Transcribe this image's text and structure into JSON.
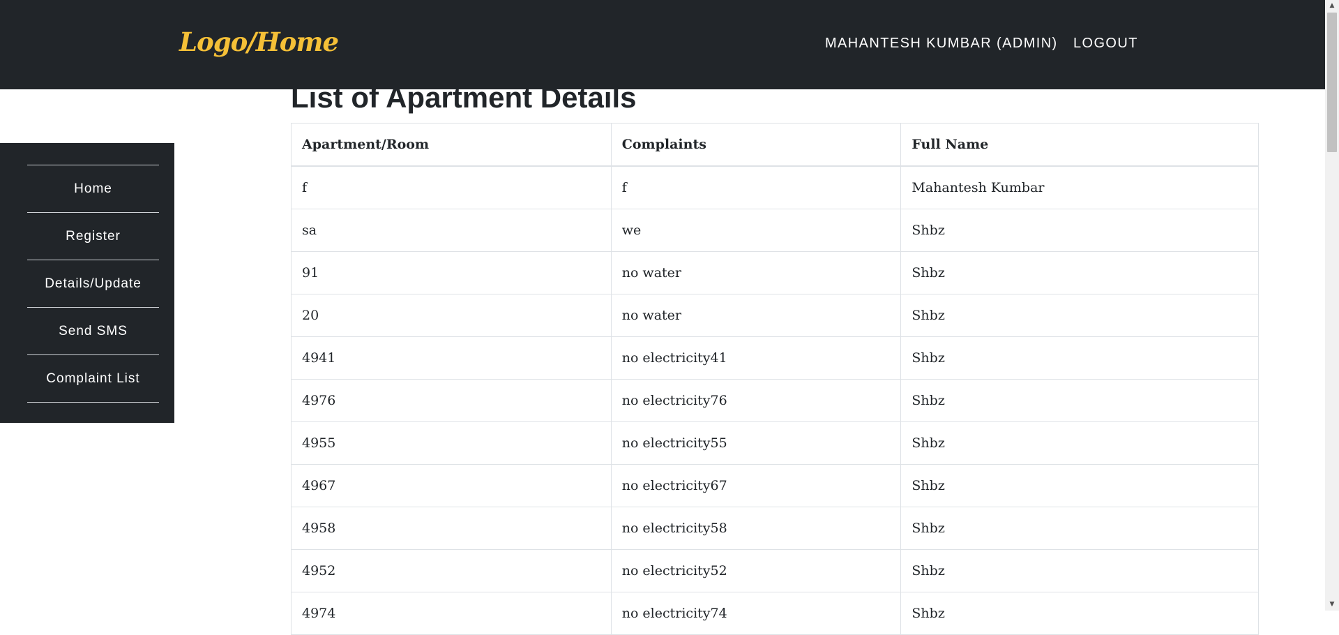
{
  "header": {
    "logo": "Logo/Home",
    "user": "MAHANTESH KUMBAR (ADMIN)",
    "logout": "LOGOUT"
  },
  "page": {
    "title": "List of Apartment Details"
  },
  "sidebar": {
    "items": [
      {
        "label": "Home"
      },
      {
        "label": "Register"
      },
      {
        "label": "Details/Update"
      },
      {
        "label": "Send SMS"
      },
      {
        "label": "Complaint List"
      }
    ]
  },
  "table": {
    "headers": [
      "Apartment/Room",
      "Complaints",
      "Full Name"
    ],
    "rows": [
      [
        "f",
        "f",
        "Mahantesh Kumbar"
      ],
      [
        "sa",
        "we",
        "Shbz"
      ],
      [
        "91",
        "no water",
        "Shbz"
      ],
      [
        "20",
        "no water",
        "Shbz"
      ],
      [
        "4941",
        "no electricity41",
        "Shbz"
      ],
      [
        "4976",
        "no electricity76",
        "Shbz"
      ],
      [
        "4955",
        "no electricity55",
        "Shbz"
      ],
      [
        "4967",
        "no electricity67",
        "Shbz"
      ],
      [
        "4958",
        "no electricity58",
        "Shbz"
      ],
      [
        "4952",
        "no electricity52",
        "Shbz"
      ],
      [
        "4974",
        "no electricity74",
        "Shbz"
      ]
    ]
  },
  "colors": {
    "header_bg": "#212529",
    "logo": "#f5c037",
    "sidebar_bg": "#212529",
    "table_border": "#dee2e6"
  },
  "icons": {
    "scroll_up": "triangle-up-icon",
    "scroll_down": "triangle-down-icon"
  }
}
